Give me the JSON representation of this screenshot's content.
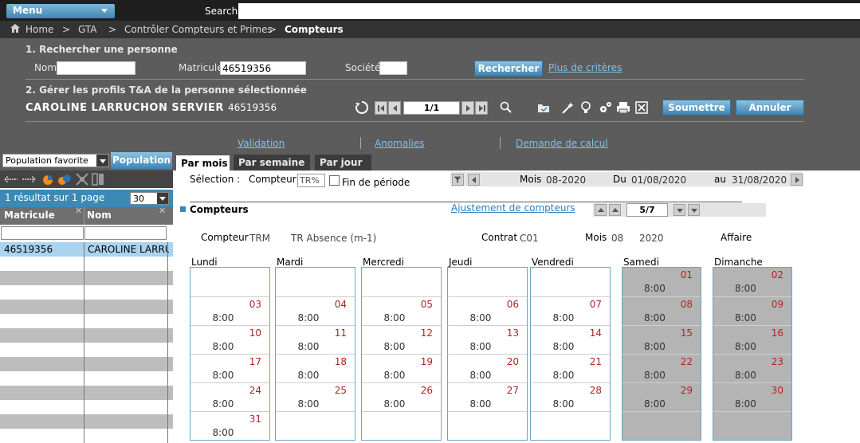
{
  "topbar": {
    "menu_label": "Menu",
    "search_label": "Search"
  },
  "breadcrumb": {
    "home": "Home",
    "sep": ">",
    "items": [
      "GTA",
      "Contrôler Compteurs et Primes",
      "Compteurs"
    ]
  },
  "search_section": {
    "title": "1. Rechercher une personne",
    "nom_label": "Nom",
    "nom_value": "",
    "matricule_label": "Matricule",
    "matricule_value": "46519356",
    "societe_label": "Société",
    "societe_value": "",
    "search_button": "Rechercher",
    "more_link": "Plus de critères"
  },
  "profile_section": {
    "title": "2. Gérer les profils T&A de la personne sélectionnée",
    "person_name": "CAROLINE LARRUCHON SERVIER",
    "person_id": "46519356",
    "page_indicator": "1/1",
    "submit_button": "Soumettre",
    "cancel_button": "Annuler"
  },
  "links": {
    "validation": "Validation",
    "anomalies": "Anomalies",
    "demande": "Demande de calcul"
  },
  "sidebar": {
    "population_select": "Population favorite",
    "population_button": "Population",
    "result_text": "1 résultat sur 1 page",
    "per_page": "30",
    "col_matricule": "Matricule",
    "col_nom": "Nom",
    "row_matricule": "46519356",
    "row_nom": "CAROLINE LARRUCHON"
  },
  "tabs": [
    "Par mois",
    "Par semaine",
    "Par jour"
  ],
  "selection": {
    "label": "Sélection :",
    "compteur_label": "Compteur",
    "compteur_value": "TR%",
    "fin_periode": "Fin de période",
    "mois_label": "Mois",
    "mois_value": "08-2020",
    "du_label": "Du",
    "du_value": "01/08/2020",
    "au_label": "au",
    "au_value": "31/08/2020"
  },
  "compteurs": {
    "title": "Compteurs",
    "ajustement_link": "Ajustement de compteurs",
    "pager": "5/7",
    "info": {
      "compteur_label": "Compteur",
      "compteur_code": "TRM",
      "compteur_desc": "TR Absence (m-1)",
      "contrat_label": "Contrat",
      "contrat_value": "C01",
      "mois_label": "Mois",
      "mois_value": "08",
      "annee_value": "2020",
      "affaire_label": "Affaire"
    }
  },
  "calendar": {
    "days": [
      "Lundi",
      "Mardi",
      "Mercredi",
      "Jeudi",
      "Vendredi",
      "Samedi",
      "Dimanche"
    ],
    "weeks": [
      [
        null,
        null,
        null,
        null,
        null,
        {
          "d": "01",
          "v": "8:00"
        },
        {
          "d": "02",
          "v": "8:00"
        }
      ],
      [
        {
          "d": "03",
          "v": "8:00"
        },
        {
          "d": "04",
          "v": "8:00"
        },
        {
          "d": "05",
          "v": "8:00"
        },
        {
          "d": "06",
          "v": "8:00"
        },
        {
          "d": "07",
          "v": "8:00"
        },
        {
          "d": "08",
          "v": "8:00"
        },
        {
          "d": "09",
          "v": "8:00"
        }
      ],
      [
        {
          "d": "10",
          "v": "8:00"
        },
        {
          "d": "11",
          "v": "8:00"
        },
        {
          "d": "12",
          "v": "8:00"
        },
        {
          "d": "13",
          "v": "8:00"
        },
        {
          "d": "14",
          "v": "8:00"
        },
        {
          "d": "15",
          "v": "8:00"
        },
        {
          "d": "16",
          "v": "8:00"
        }
      ],
      [
        {
          "d": "17",
          "v": "8:00"
        },
        {
          "d": "18",
          "v": "8:00"
        },
        {
          "d": "19",
          "v": "8:00"
        },
        {
          "d": "20",
          "v": "8:00"
        },
        {
          "d": "21",
          "v": "8:00"
        },
        {
          "d": "22",
          "v": "8:00"
        },
        {
          "d": "23",
          "v": "8:00"
        }
      ],
      [
        {
          "d": "24",
          "v": "8:00"
        },
        {
          "d": "25",
          "v": "8:00"
        },
        {
          "d": "26",
          "v": "8:00"
        },
        {
          "d": "27",
          "v": "8:00"
        },
        {
          "d": "28",
          "v": "8:00"
        },
        {
          "d": "29",
          "v": "8:00"
        },
        {
          "d": "30",
          "v": "8:00"
        }
      ],
      [
        {
          "d": "31",
          "v": "8:00"
        },
        null,
        null,
        null,
        null,
        null,
        null
      ]
    ]
  },
  "colors": {
    "accent": "#3d84b2",
    "panel": "#5c5c5c",
    "date_red": "#b22222",
    "link": "#2a7fc0"
  }
}
